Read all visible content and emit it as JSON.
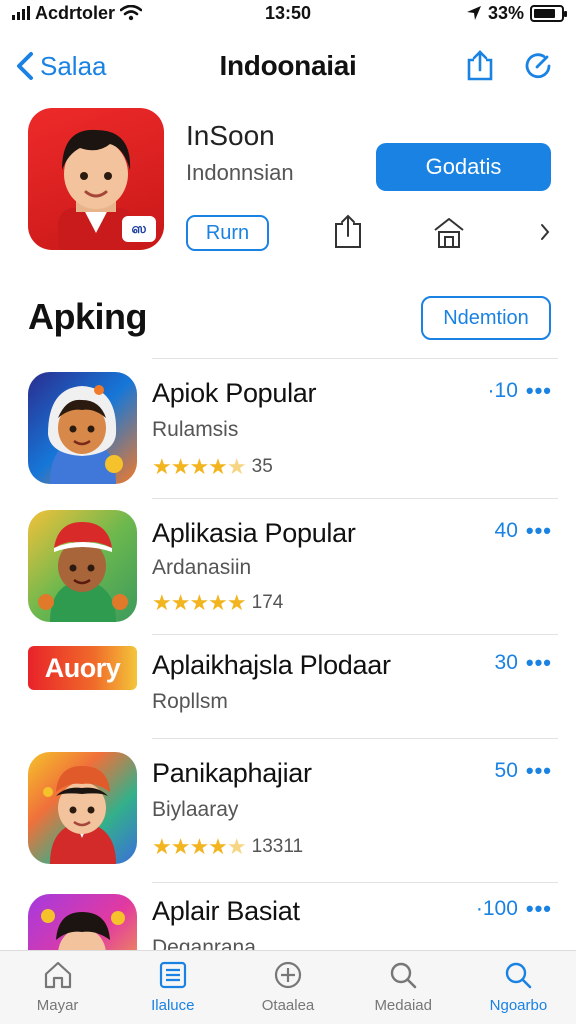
{
  "status_bar": {
    "carrier": "Acdrtoler",
    "time": "13:50",
    "battery": "33%",
    "battery_level": 0.8
  },
  "nav": {
    "back_label": "Salaa",
    "title": "Indoonaiai",
    "icons": [
      "share-icon",
      "refresh-icon"
    ]
  },
  "app": {
    "name": "InSoon",
    "subtitle": "Indonnsian",
    "get_label": "Godatis",
    "run_label": "Rurn",
    "icon_badge": "ஸ"
  },
  "section": {
    "title": "Apking",
    "button_label": "Ndemtion"
  },
  "items": [
    {
      "title": "Apiok Popular",
      "subtitle": "Rulamsis",
      "rating_count": "35",
      "stars": 4.5,
      "price": "·10",
      "more": "•••",
      "icon": "avatar-blue"
    },
    {
      "title": "Aplikasia Popular",
      "subtitle": "Ardanasiin",
      "rating_count": "174",
      "stars": 5,
      "price": "40",
      "more": "•••",
      "icon": "avatar-green"
    },
    {
      "title": "Aplaikhajsla Plodaar",
      "subtitle": "Ropllsm",
      "price": "30",
      "more": "•••",
      "icon": "banner",
      "banner_text": "Auory"
    },
    {
      "title": "Panikaphajiar",
      "subtitle": "Biylaaray",
      "rating_count": "13311",
      "stars": 4.5,
      "price": "50",
      "more": "•••",
      "icon": "avatar-rainbow"
    },
    {
      "title": "Aplair Basiat",
      "subtitle": "Deganrana",
      "price": "·100",
      "more": "•••",
      "icon": "avatar-purple"
    }
  ],
  "tabs": [
    {
      "label": "Mayar",
      "icon": "home-icon"
    },
    {
      "label": "Ilaluce",
      "icon": "list-icon"
    },
    {
      "label": "Otaalea",
      "icon": "compass-icon"
    },
    {
      "label": "Medaiad",
      "icon": "search-icon"
    },
    {
      "label": "Ngoarbo",
      "icon": "search-icon"
    }
  ],
  "colors": {
    "accent": "#1a82e2",
    "star": "#f2b51f",
    "app_icon_red": "#e22222"
  }
}
